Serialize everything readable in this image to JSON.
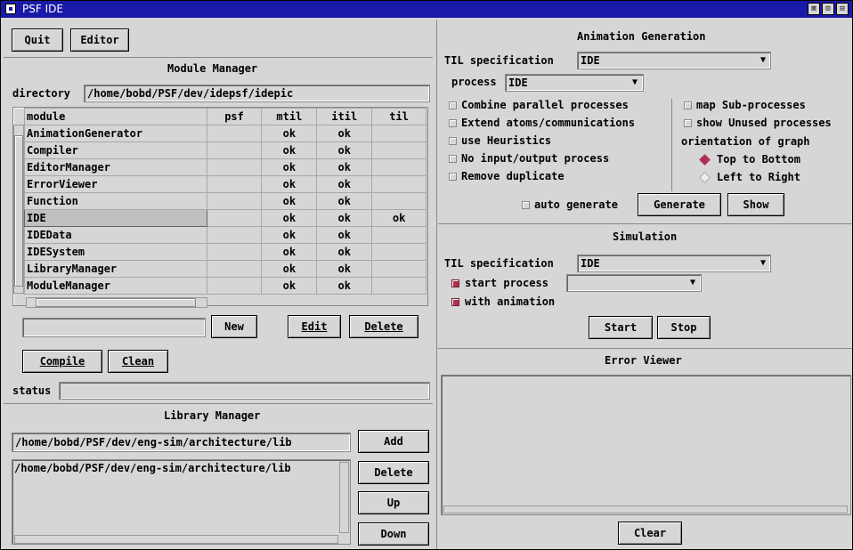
{
  "window": {
    "title": "PSF IDE",
    "buttons": [
      "⊠",
      "⊡",
      "⊟"
    ]
  },
  "toolbar": {
    "quit": "Quit",
    "editor": "Editor"
  },
  "module_manager": {
    "title": "Module Manager",
    "directory_label": "directory",
    "directory_value": "/home/bobd/PSF/dev/idepsf/idepic",
    "columns": [
      "module",
      "psf",
      "mtil",
      "itil",
      "til"
    ],
    "rows": [
      {
        "module": "AnimationGenerator",
        "psf": "",
        "mtil": "ok",
        "itil": "ok",
        "til": ""
      },
      {
        "module": "Compiler",
        "psf": "",
        "mtil": "ok",
        "itil": "ok",
        "til": ""
      },
      {
        "module": "EditorManager",
        "psf": "",
        "mtil": "ok",
        "itil": "ok",
        "til": ""
      },
      {
        "module": "ErrorViewer",
        "psf": "",
        "mtil": "ok",
        "itil": "ok",
        "til": ""
      },
      {
        "module": "Function",
        "psf": "",
        "mtil": "ok",
        "itil": "ok",
        "til": ""
      },
      {
        "module": "IDE",
        "psf": "",
        "mtil": "ok",
        "itil": "ok",
        "til": "ok"
      },
      {
        "module": "IDEData",
        "psf": "",
        "mtil": "ok",
        "itil": "ok",
        "til": ""
      },
      {
        "module": "IDESystem",
        "psf": "",
        "mtil": "ok",
        "itil": "ok",
        "til": ""
      },
      {
        "module": "LibraryManager",
        "psf": "",
        "mtil": "ok",
        "itil": "ok",
        "til": ""
      },
      {
        "module": "ModuleManager",
        "psf": "",
        "mtil": "ok",
        "itil": "ok",
        "til": ""
      }
    ],
    "selected_row": 5,
    "new_input": "",
    "new": "New",
    "edit": "Edit",
    "delete": "Delete",
    "compile": "Compile",
    "clean": "Clean",
    "status_label": "status",
    "status_value": ""
  },
  "library_manager": {
    "title": "Library Manager",
    "path_input": "/home/bobd/PSF/dev/eng-sim/architecture/lib",
    "items": [
      "/home/bobd/PSF/dev/eng-sim/architecture/lib"
    ],
    "add": "Add",
    "delete": "Delete",
    "up": "Up",
    "down": "Down"
  },
  "animation": {
    "title": "Animation Generation",
    "til_label": "TIL specification",
    "til_value": "IDE",
    "process_label": "process",
    "process_value": "IDE",
    "options_left": [
      {
        "label": "Combine parallel processes",
        "checked": false
      },
      {
        "label": "Extend atoms/communications",
        "checked": false
      },
      {
        "label": "use Heuristics",
        "checked": false
      },
      {
        "label": "No input/output process",
        "checked": false
      },
      {
        "label": "Remove duplicate",
        "checked": false
      }
    ],
    "options_right": [
      {
        "label": "map Sub-processes",
        "checked": false
      },
      {
        "label": "show Unused processes",
        "checked": false
      }
    ],
    "orientation_label": "orientation of graph",
    "orientation": [
      {
        "label": "Top to Bottom",
        "selected": true
      },
      {
        "label": "Left to Right",
        "selected": false
      }
    ],
    "auto_generate": "auto generate",
    "generate": "Generate",
    "show": "Show"
  },
  "simulation": {
    "title": "Simulation",
    "til_label": "TIL specification",
    "til_value": "IDE",
    "start_process_label": "start process",
    "start_process_value": "",
    "with_animation_label": "with animation",
    "start": "Start",
    "stop": "Stop"
  },
  "error_viewer": {
    "title": "Error Viewer",
    "clear": "Clear"
  },
  "colors": {
    "titlebar": "#1a1aa8",
    "background": "#d6d6d6",
    "checked": "#b03050"
  }
}
